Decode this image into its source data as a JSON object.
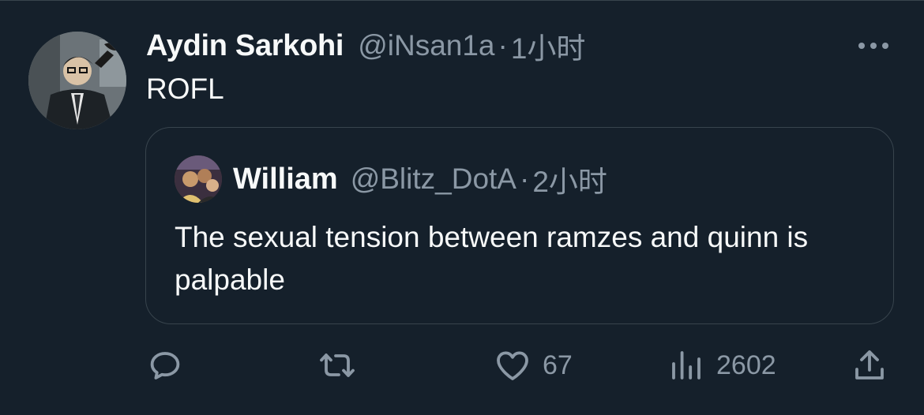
{
  "tweet": {
    "author_name": "Aydin Sarkohi",
    "author_handle": "@iNsan1a",
    "separator": "·",
    "time": "1小时",
    "text": "ROFL"
  },
  "quoted": {
    "author_name": "William",
    "author_handle": "@Blitz_DotA",
    "separator": "·",
    "time": "2小时",
    "text": "The sexual tension between ramzes and quinn is palpable"
  },
  "actions": {
    "reply": {
      "icon": "reply-icon",
      "count": ""
    },
    "retweet": {
      "icon": "retweet-icon",
      "count": ""
    },
    "like": {
      "icon": "heart-icon",
      "count": "67"
    },
    "views": {
      "icon": "views-icon",
      "count": "2602"
    },
    "share": {
      "icon": "share-icon"
    }
  },
  "colors": {
    "background": "#15202b",
    "text_primary": "#f7f9f9",
    "text_secondary": "#8b98a5",
    "border": "#38444d"
  }
}
